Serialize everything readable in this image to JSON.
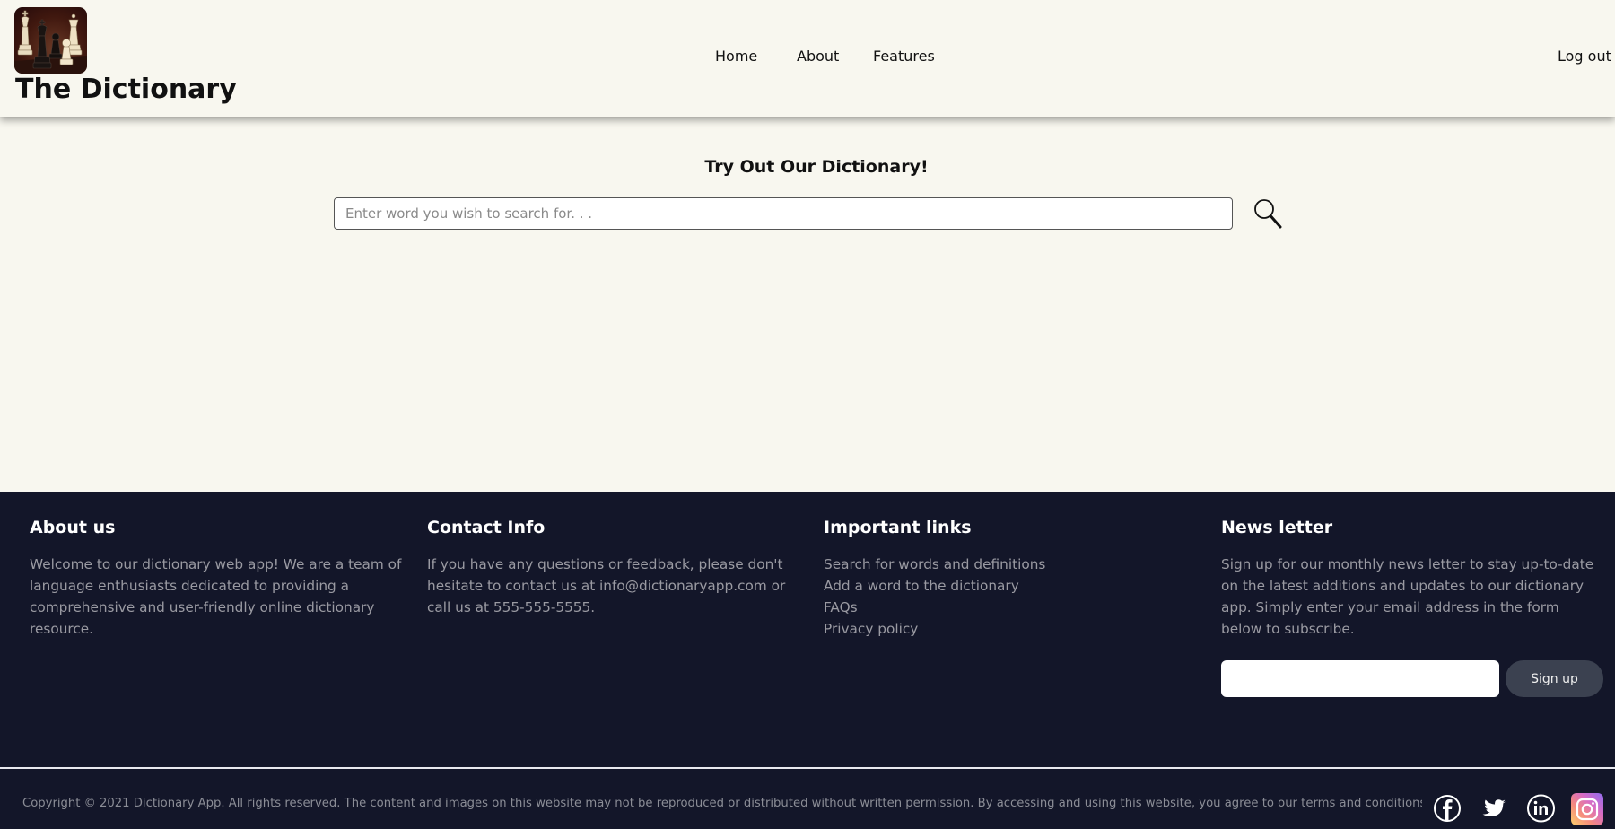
{
  "header": {
    "brand": "The Dictionary",
    "logo_icon": "chess-pieces-logo",
    "nav": {
      "home": "Home",
      "about": "About",
      "features": "Features",
      "logout": "Log out"
    }
  },
  "main": {
    "title": "Try Out Our Dictionary!",
    "search_placeholder": "Enter word you wish to search for. . .",
    "search_icon": "search-icon"
  },
  "footer": {
    "about": {
      "heading": "About us",
      "text": "Welcome to our dictionary web app! We are a team of language enthusiasts dedicated to providing a comprehensive and user-friendly online dictionary resource."
    },
    "contact": {
      "heading": "Contact Info",
      "text": "If you have any questions or feedback, please don't hesitate to contact us at info@dictionaryapp.com or call us at 555-555-5555."
    },
    "links": {
      "heading": "Important links",
      "items": [
        "Search for words and definitions",
        "Add a word to the dictionary",
        "FAQs",
        "Privacy policy"
      ]
    },
    "newsletter": {
      "heading": "News letter",
      "text": "Sign up for our monthly news letter to stay up-to-date on the latest additions and updates to our dictionary app. Simply enter your email address in the form below to subscribe.",
      "email_value": "",
      "button": "Sign up"
    },
    "copyright": "Copyright © 2021 Dictionary App. All rights reserved. The content and images on this website may not be reproduced or distributed without written permission. By accessing and using this website, you agree to our terms and conditions.",
    "social_icons": [
      "facebook-icon",
      "twitter-icon",
      "linkedin-icon",
      "instagram-icon"
    ]
  },
  "colors": {
    "page_bg": "#f8f7ef",
    "footer_bg": "#131629",
    "footer_text": "#9a9aa2",
    "signup_button": "#3b4150"
  }
}
